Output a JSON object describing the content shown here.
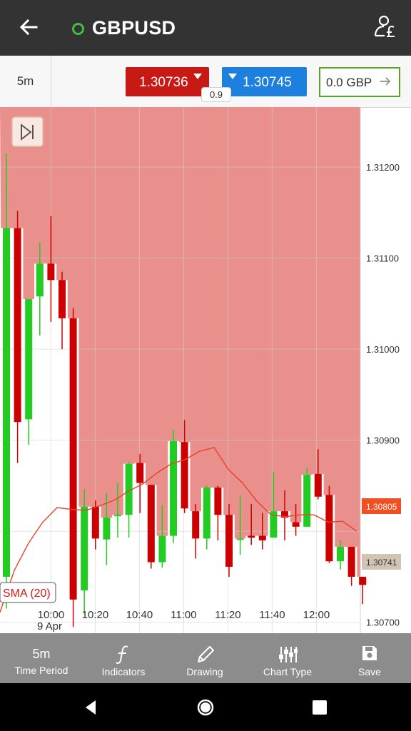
{
  "header": {
    "title": "GBPUSD",
    "colors": {
      "bar": "#333333",
      "status_dot": "#3fbf3f"
    },
    "icons": [
      "back-arrow-icon",
      "status-dot-icon",
      "account-pound-icon"
    ]
  },
  "trade_bar": {
    "timeframe": "5m",
    "sell_price": "1.30736",
    "buy_price": "1.30745",
    "spread": "0.9",
    "amount": "0.0 GBP",
    "colors": {
      "sell": "#c81a14",
      "buy": "#1d7fde",
      "amount_border": "#5aa32c"
    }
  },
  "chart": {
    "skip_to_end_icon": "skip-to-end-icon",
    "indicator_label": "SMA (20)",
    "current_bid_label": "1.30805",
    "current_price_label": "1.30741",
    "date_label": "9 Apr",
    "colors": {
      "shade": "#e9908c",
      "bull": "#22cc22",
      "bear": "#cc0000",
      "sma": "#e8412a"
    }
  },
  "chart_data": {
    "type": "candlestick",
    "y_ticks": [
      "1.31200",
      "1.31100",
      "1.31000",
      "1.30900",
      "1.30700"
    ],
    "y_tick_values": [
      1.312,
      1.311,
      1.31,
      1.309,
      1.307
    ],
    "x_ticks": [
      "10:00",
      "10:20",
      "10:40",
      "11:00",
      "11:20",
      "11:40",
      "12:00"
    ],
    "ylim": [
      1.30688,
      1.31266
    ],
    "series": [
      {
        "name": "SMA (20)",
        "values": [
          1.30757,
          1.30787,
          1.3081,
          1.30826,
          1.30824,
          1.30823,
          1.30828,
          1.30834,
          1.30844,
          1.30852,
          1.30864,
          1.30874,
          1.30879,
          1.30888,
          1.30892,
          1.30868,
          1.30853,
          1.30833,
          1.30818,
          1.30816,
          1.30818,
          1.30818,
          1.3081,
          1.30811,
          1.308
        ]
      }
    ],
    "candles": [
      {
        "o": 1.3075,
        "h": 1.31215,
        "l": 1.30715,
        "c": 1.31133
      },
      {
        "o": 1.31133,
        "h": 1.31152,
        "l": 1.30875,
        "c": 1.3092
      },
      {
        "o": 1.30923,
        "h": 1.31055,
        "l": 1.30895,
        "c": 1.31055
      },
      {
        "o": 1.31058,
        "h": 1.31117,
        "l": 1.31015,
        "c": 1.31094
      },
      {
        "o": 1.31094,
        "h": 1.31146,
        "l": 1.3103,
        "c": 1.31076
      },
      {
        "o": 1.31076,
        "h": 1.31085,
        "l": 1.31,
        "c": 1.31034
      },
      {
        "o": 1.31034,
        "h": 1.31045,
        "l": 1.30695,
        "c": 1.30725
      },
      {
        "o": 1.30735,
        "h": 1.30846,
        "l": 1.3071,
        "c": 1.30827
      },
      {
        "o": 1.30827,
        "h": 1.30834,
        "l": 1.3078,
        "c": 1.30792
      },
      {
        "o": 1.30791,
        "h": 1.30842,
        "l": 1.30763,
        "c": 1.30815
      },
      {
        "o": 1.30817,
        "h": 1.30853,
        "l": 1.30793,
        "c": 1.30818
      },
      {
        "o": 1.30818,
        "h": 1.30876,
        "l": 1.30793,
        "c": 1.30874
      },
      {
        "o": 1.30875,
        "h": 1.30885,
        "l": 1.3082,
        "c": 1.30853
      },
      {
        "o": 1.30851,
        "h": 1.30851,
        "l": 1.30759,
        "c": 1.30766
      },
      {
        "o": 1.30766,
        "h": 1.30829,
        "l": 1.3076,
        "c": 1.30795
      },
      {
        "o": 1.30795,
        "h": 1.30912,
        "l": 1.30787,
        "c": 1.30899
      },
      {
        "o": 1.30898,
        "h": 1.30922,
        "l": 1.3082,
        "c": 1.30825
      },
      {
        "o": 1.30822,
        "h": 1.3083,
        "l": 1.3077,
        "c": 1.30792
      },
      {
        "o": 1.30792,
        "h": 1.3085,
        "l": 1.3078,
        "c": 1.30848
      },
      {
        "o": 1.30848,
        "h": 1.3085,
        "l": 1.3079,
        "c": 1.30818
      },
      {
        "o": 1.30818,
        "h": 1.3083,
        "l": 1.3075,
        "c": 1.30761
      },
      {
        "o": 1.30792,
        "h": 1.30839,
        "l": 1.30774,
        "c": 1.30792
      },
      {
        "o": 1.30795,
        "h": 1.3083,
        "l": 1.30785,
        "c": 1.30793
      },
      {
        "o": 1.30795,
        "h": 1.3082,
        "l": 1.3078,
        "c": 1.3079
      },
      {
        "o": 1.30793,
        "h": 1.30865,
        "l": 1.30793,
        "c": 1.30822
      },
      {
        "o": 1.30822,
        "h": 1.30845,
        "l": 1.3079,
        "c": 1.30815
      },
      {
        "o": 1.3081,
        "h": 1.3083,
        "l": 1.30795,
        "c": 1.30805
      },
      {
        "o": 1.30805,
        "h": 1.3087,
        "l": 1.30805,
        "c": 1.30862
      },
      {
        "o": 1.30863,
        "h": 1.3089,
        "l": 1.30835,
        "c": 1.30838
      },
      {
        "o": 1.3084,
        "h": 1.3085,
        "l": 1.30765,
        "c": 1.30767
      },
      {
        "o": 1.30767,
        "h": 1.3079,
        "l": 1.30758,
        "c": 1.30783
      },
      {
        "o": 1.30783,
        "h": 1.30783,
        "l": 1.3074,
        "c": 1.3075
      },
      {
        "o": 1.3075,
        "h": 1.3075,
        "l": 1.3072,
        "c": 1.30741
      }
    ]
  },
  "toolbar": {
    "items": [
      {
        "top": "5m",
        "label": "Time Period",
        "icon": "time-period-icon"
      },
      {
        "label": "Indicators",
        "icon": "function-icon"
      },
      {
        "label": "Drawing",
        "icon": "pencil-icon"
      },
      {
        "label": "Chart Type",
        "icon": "sliders-icon"
      },
      {
        "label": "Save",
        "icon": "floppy-disk-icon"
      }
    ]
  },
  "nav": {
    "icons": [
      "back-triangle-icon",
      "home-circle-icon",
      "recents-square-icon"
    ]
  }
}
